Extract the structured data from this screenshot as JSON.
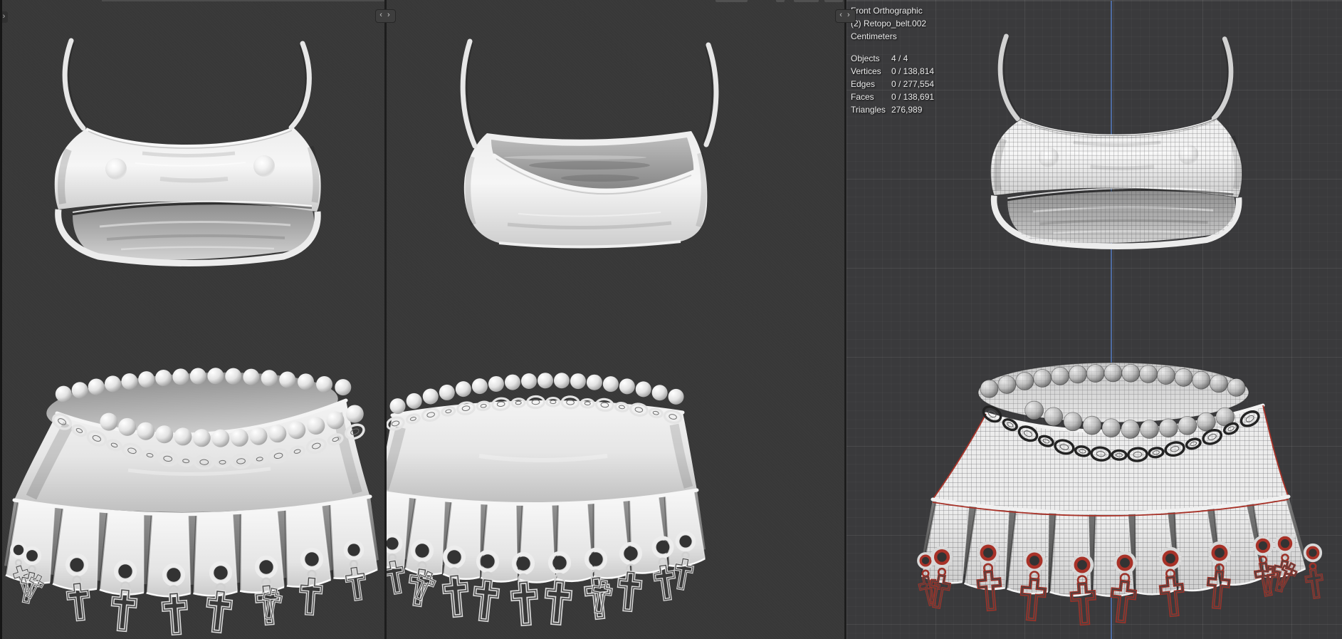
{
  "overlay": {
    "view": "Front Orthographic",
    "object": "(2) Retopo_belt.002",
    "units": "Centimeters",
    "stats": [
      {
        "label": "Objects",
        "value": "4 / 4"
      },
      {
        "label": "Vertices",
        "value": "0 / 138,814"
      },
      {
        "label": "Edges",
        "value": "0 / 277,554"
      },
      {
        "label": "Faces",
        "value": "0 / 138,691"
      },
      {
        "label": "Triangles",
        "value": "276,989"
      }
    ]
  },
  "icons": {
    "panel_resize_handle": "‹ ›",
    "viewport_sidebar_toggle": "›"
  },
  "colors": {
    "viewport_bg": "#383838",
    "wireframe_bg": "#3a3a3c",
    "divider": "#1d1d1d",
    "axis_blue": "#5377b8",
    "selection_red": "#a83228",
    "text_primary": "#eaeaea",
    "cloth_light": "#f2f2f2",
    "cloth_shadow": "#9a9a9a",
    "metal_silver": "#e4e4e4",
    "chain_dark": "#232323"
  }
}
